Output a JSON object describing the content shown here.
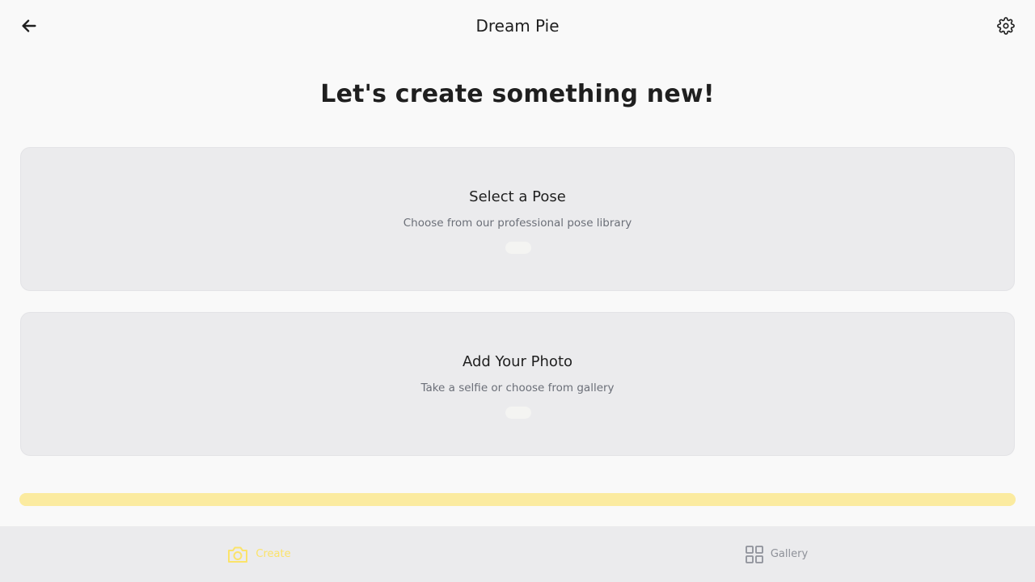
{
  "header": {
    "title": "Dream Pie",
    "back_icon": "arrow-left-icon",
    "settings_icon": "gear-icon"
  },
  "main": {
    "heading": "Let's create something new!",
    "cards": [
      {
        "title": "Select a Pose",
        "subtitle": "Choose from our professional pose library"
      },
      {
        "title": "Add Your Photo",
        "subtitle": "Take a selfie or choose from gallery"
      }
    ],
    "progress": 1.0
  },
  "bottom_nav": {
    "items": [
      {
        "label": "Create",
        "icon": "camera-icon",
        "active": true
      },
      {
        "label": "Gallery",
        "icon": "grid-icon",
        "active": false
      }
    ]
  },
  "colors": {
    "accent": "#fbe36a",
    "progress": "#fbeba0",
    "card_bg": "#ebebed",
    "inactive": "#8e9199"
  }
}
